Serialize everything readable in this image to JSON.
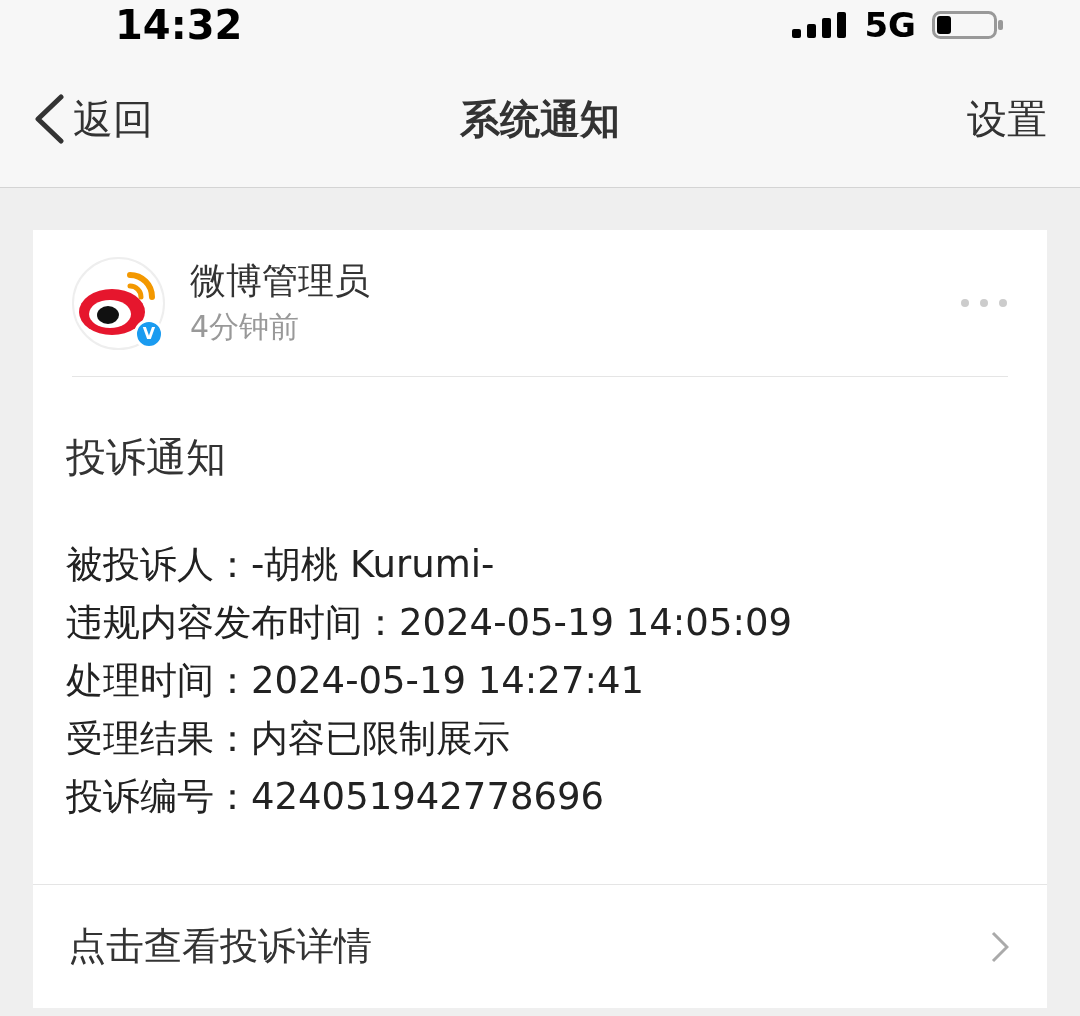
{
  "status_bar": {
    "time": "14:32",
    "network": "5G"
  },
  "nav": {
    "back": "返回",
    "title": "系统通知",
    "action": "设置"
  },
  "message": {
    "sender": "微博管理员",
    "badge": "V",
    "time": "4分钟前",
    "title": "投诉通知",
    "fields": [
      {
        "label": "被投诉人：",
        "value": "-胡桃 Kurumi-"
      },
      {
        "label": "违规内容发布时间：",
        "value": "2024-05-19 14:05:09"
      },
      {
        "label": "处理时间：",
        "value": "2024-05-19 14:27:41"
      },
      {
        "label": "受理结果：",
        "value": "内容已限制展示"
      },
      {
        "label": "投诉编号：",
        "value": "424051942778696"
      }
    ],
    "link": "点击查看投诉详情"
  }
}
